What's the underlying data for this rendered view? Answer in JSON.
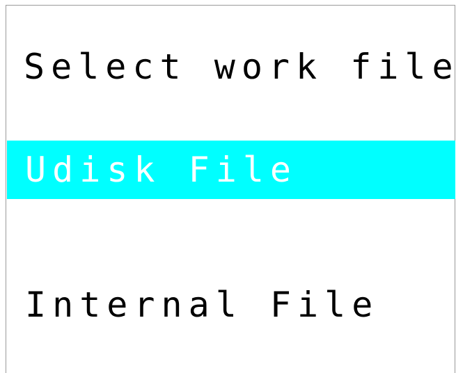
{
  "header": {
    "title": "Select work file"
  },
  "menu": {
    "items": [
      {
        "label": "Udisk File",
        "selected": true
      },
      {
        "label": "Internal File",
        "selected": false
      }
    ]
  },
  "colors": {
    "background": "#ffffff",
    "selected_highlight": "#00ffff",
    "selected_text": "#ffffff",
    "text": "#000000"
  }
}
